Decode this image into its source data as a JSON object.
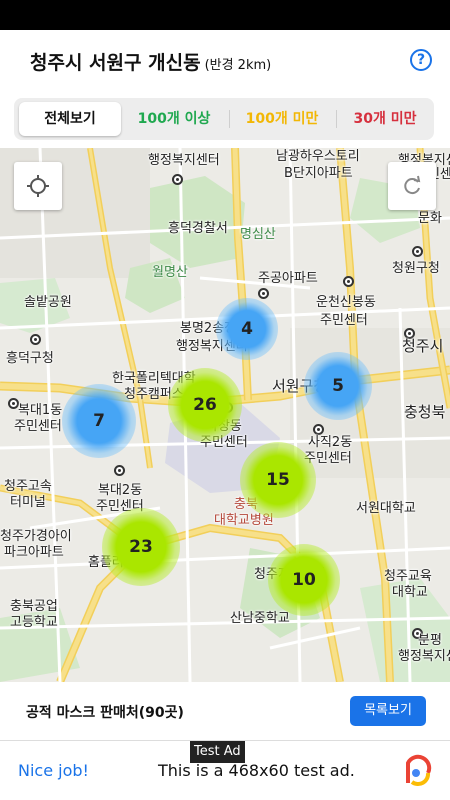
{
  "header": {
    "title": "청주시 서원구 개신동",
    "subtitle": "(반경 2km)",
    "help_icon": "question-circle-icon"
  },
  "filters": [
    {
      "label": "전체보기",
      "color": "#111111",
      "active": true
    },
    {
      "label": "100개 이상",
      "color": "#1fa84f",
      "active": false
    },
    {
      "label": "100개 미만",
      "color": "#f2b705",
      "active": false
    },
    {
      "label": "30개 미만",
      "color": "#d6303e",
      "active": false
    }
  ],
  "map": {
    "locate_icon": "crosshair-icon",
    "refresh_icon": "refresh-icon",
    "labels": {
      "l1": "행정복지센터",
      "l2": "남광하우스토리",
      "l3": "B단지아파트",
      "l4": "행정복지센터",
      "l5": "흥덕경찰서",
      "l6": "명심산",
      "l7": "월명산",
      "l8": "청원구청",
      "l9": "주공아파트",
      "l10": "솔밭공원",
      "l11": "운천신봉동",
      "l12": "주민센터",
      "l13": "봉명2송정동",
      "l14": "행정복지센터",
      "l15": "청주시",
      "l16": "흥덕구청",
      "l17": "한국폴리텍대학",
      "l18": "청주캠퍼스",
      "l19": "서원구청",
      "l20": "충청북",
      "l21": "복대1동",
      "l22": "주민센터",
      "l23": "사창동",
      "l24": "주민센터",
      "l25": "사직2동",
      "l26": "주민센터",
      "l27": "청주고속",
      "l28": "터미널",
      "l29": "복대2동",
      "l30": "주민센터",
      "l31": "충북",
      "l32": "대학교병원",
      "l33": "서원대학교",
      "l34": "청주가경아이",
      "l35": "파크아파트",
      "l36": "홈플러스",
      "l37": "청주지방법원",
      "l38": "충북공업",
      "l39": "고등학교",
      "l40": "산남중학교",
      "l41": "청주교육",
      "l42": "대학교",
      "l43": "분평",
      "l44": "행정복지센터",
      "l45": "문화",
      "l46": "주민센터"
    },
    "clusters": [
      {
        "count": "4",
        "type": "blue"
      },
      {
        "count": "5",
        "type": "blue"
      },
      {
        "count": "7",
        "type": "blue"
      },
      {
        "count": "26",
        "type": "green"
      },
      {
        "count": "15",
        "type": "green"
      },
      {
        "count": "23",
        "type": "green"
      },
      {
        "count": "10",
        "type": "green"
      }
    ]
  },
  "bottom": {
    "count_label": "공적 마스크 판매처(90곳)",
    "list_button": "목록보기"
  },
  "ad": {
    "tag": "Test Ad",
    "left_text": "Nice job!",
    "text": "This is a 468x60 test ad.",
    "logo_icon": "adchoices-logo-icon"
  }
}
